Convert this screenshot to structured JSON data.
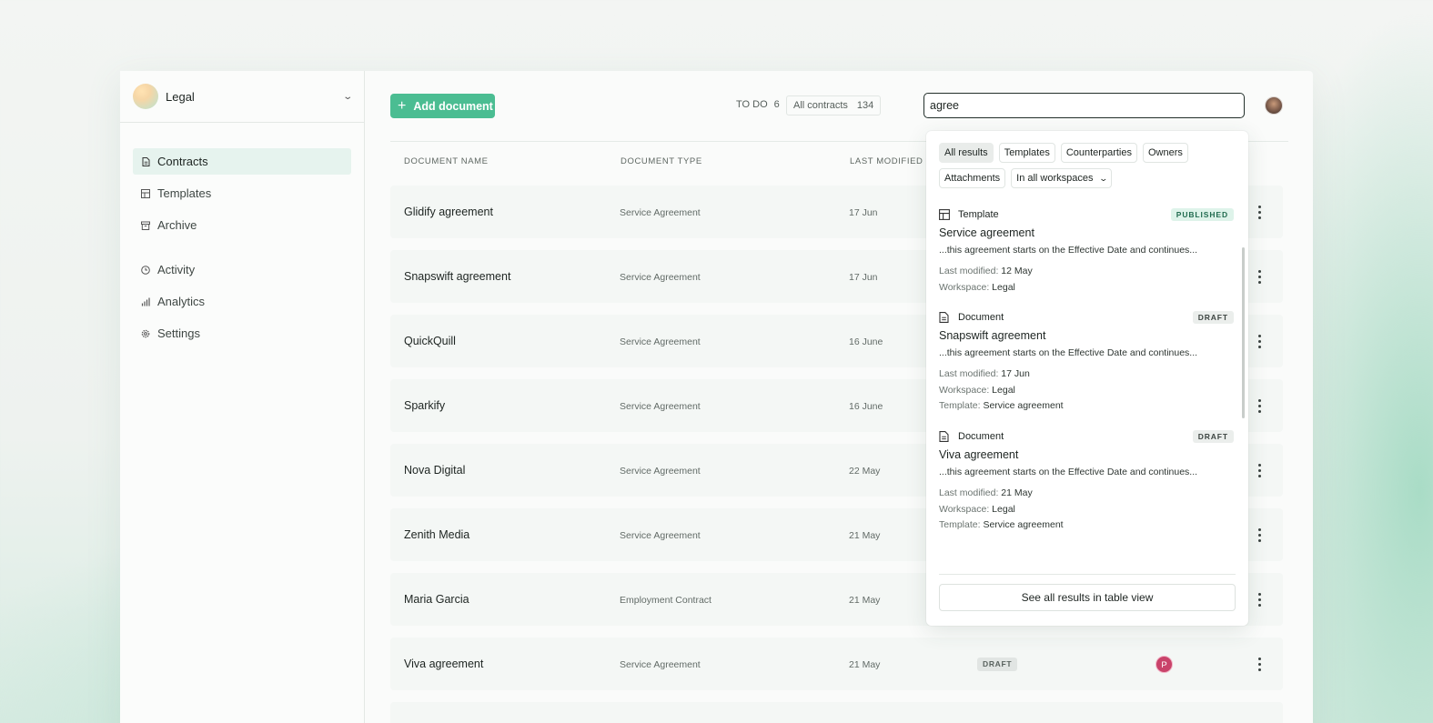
{
  "colors": {
    "accent": "#4bbd92",
    "owner_avatar": "#c9436a",
    "published_badge": "#def3ea"
  },
  "sidebar": {
    "workspace": "Legal",
    "items": [
      {
        "label": "Contracts",
        "icon": "document-icon",
        "active": true
      },
      {
        "label": "Templates",
        "icon": "template-icon",
        "active": false
      },
      {
        "label": "Archive",
        "icon": "archive-icon",
        "active": false
      },
      {
        "label": "Activity",
        "icon": "clock-icon",
        "active": false
      },
      {
        "label": "Analytics",
        "icon": "bar-chart-icon",
        "active": false
      },
      {
        "label": "Settings",
        "icon": "gear-icon",
        "active": false
      }
    ]
  },
  "toolbar": {
    "add_label": "Add document",
    "todo_label": "TO DO",
    "todo_count": "6",
    "all_label": "All contracts",
    "all_count": "134",
    "search_value": "agree"
  },
  "table": {
    "headers": [
      "DOCUMENT NAME",
      "DOCUMENT TYPE",
      "LAST MODIFIED"
    ],
    "rows": [
      {
        "name": "Glidify agreement",
        "type": "Service Agreement",
        "date": "17 Jun"
      },
      {
        "name": "Snapswift agreement",
        "type": "Service Agreement",
        "date": "17 Jun"
      },
      {
        "name": "QuickQuill",
        "type": "Service Agreement",
        "date": "16 June"
      },
      {
        "name": "Sparkify",
        "type": "Service Agreement",
        "date": "16 June"
      },
      {
        "name": "Nova Digital",
        "type": "Service Agreement",
        "date": "22 May"
      },
      {
        "name": "Zenith Media",
        "type": "Service Agreement",
        "date": "21 May"
      },
      {
        "name": "Maria Garcia",
        "type": "Employment Contract",
        "date": "21 May"
      },
      {
        "name": "Viva agreement",
        "type": "Service Agreement",
        "date": "21 May",
        "status": "DRAFT",
        "owner": "P"
      }
    ]
  },
  "search_dropdown": {
    "filters": [
      "All results",
      "Templates",
      "Counterparties",
      "Owners",
      "Attachments"
    ],
    "workspace_filter": "In all workspaces",
    "results": [
      {
        "kind": "Template",
        "badge": "PUBLISHED",
        "title": "Service agreement",
        "snippet": "...this agreement starts on the Effective Date and continues...",
        "last_modified_label": "Last modified:",
        "last_modified": "12 May",
        "workspace_label": "Workspace:",
        "workspace": "Legal"
      },
      {
        "kind": "Document",
        "badge": "DRAFT",
        "title": "Snapswift agreement",
        "snippet": "...this agreement starts on the Effective Date and continues...",
        "last_modified_label": "Last modified:",
        "last_modified": "17 Jun",
        "workspace_label": "Workspace:",
        "workspace": "Legal",
        "template_label": "Template:",
        "template": "Service agreement"
      },
      {
        "kind": "Document",
        "badge": "DRAFT",
        "title": "Viva agreement",
        "snippet": "...this agreement starts on the Effective Date and continues...",
        "last_modified_label": "Last modified:",
        "last_modified": "21 May",
        "workspace_label": "Workspace:",
        "workspace": "Legal",
        "template_label": "Template:",
        "template": "Service agreement"
      }
    ],
    "see_all_label": "See all results in table view"
  }
}
